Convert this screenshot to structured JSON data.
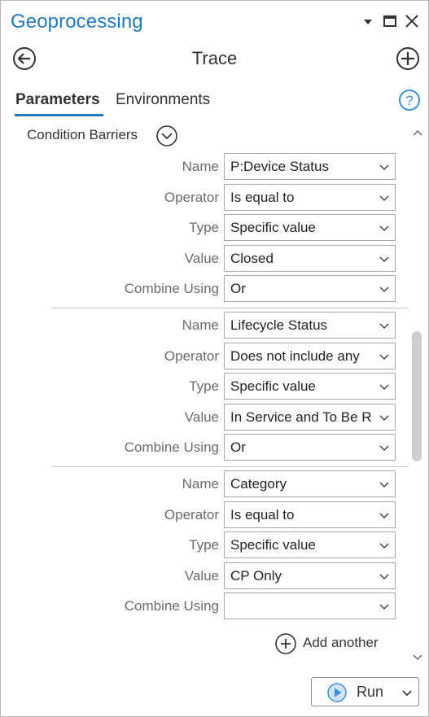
{
  "window": {
    "title": "Geoprocessing"
  },
  "tool": {
    "title": "Trace"
  },
  "tabs": [
    {
      "label": "Parameters",
      "active": true
    },
    {
      "label": "Environments",
      "active": false
    }
  ],
  "section": {
    "title": "Condition Barriers"
  },
  "barriers": [
    {
      "name_label": "Name",
      "name": "P:Device Status",
      "operator_label": "Operator",
      "operator": "Is equal to",
      "type_label": "Type",
      "type": "Specific value",
      "value_label": "Value",
      "value": "Closed",
      "combine_label": "Combine Using",
      "combine": "Or"
    },
    {
      "name_label": "Name",
      "name": "Lifecycle Status",
      "operator_label": "Operator",
      "operator": "Does not include any",
      "type_label": "Type",
      "type": "Specific value",
      "value_label": "Value",
      "value": "In Service and To Be R",
      "combine_label": "Combine Using",
      "combine": "Or"
    },
    {
      "name_label": "Name",
      "name": "Category",
      "operator_label": "Operator",
      "operator": "Is equal to",
      "type_label": "Type",
      "type": "Specific value",
      "value_label": "Value",
      "value": "CP Only",
      "combine_label": "Combine Using",
      "combine": ""
    }
  ],
  "add_another_label": "Add another",
  "run_label": "Run",
  "colors": {
    "accent": "#1f7ac0",
    "play": "#3a8fd6"
  }
}
